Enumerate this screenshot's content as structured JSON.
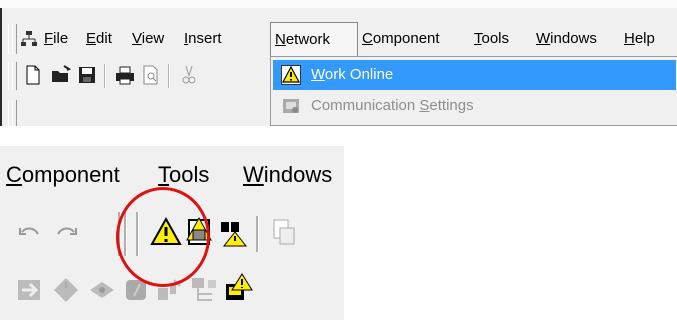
{
  "menubar": {
    "items": [
      {
        "label_u": "F",
        "label_rest": "ile"
      },
      {
        "label_u": "E",
        "label_rest": "dit"
      },
      {
        "label_u": "V",
        "label_rest": "iew"
      },
      {
        "label_u": "I",
        "label_rest": "nsert"
      },
      {
        "label_u": "N",
        "label_rest": "etwork"
      },
      {
        "label_u": "C",
        "label_rest": "omponent"
      },
      {
        "label_u": "T",
        "label_rest": "ools"
      },
      {
        "label_u": "W",
        "label_rest": "indows"
      },
      {
        "label_u": "H",
        "label_rest": "elp"
      }
    ]
  },
  "network_menu": {
    "work_online_u": "W",
    "work_online_rest": "ork Online",
    "comm_settings_pre": "Communication ",
    "comm_settings_u": "S",
    "comm_settings_rest": "ettings"
  },
  "zoomed_menubar": {
    "component_u": "C",
    "component_rest": "omponent",
    "tools_u": "T",
    "tools_rest": "ools",
    "windows_u": "W",
    "windows_rest": "indows"
  },
  "colors": {
    "highlight": "#3399ff",
    "warning_yellow": "#ffee00",
    "annotation_circle": "#e01010"
  }
}
